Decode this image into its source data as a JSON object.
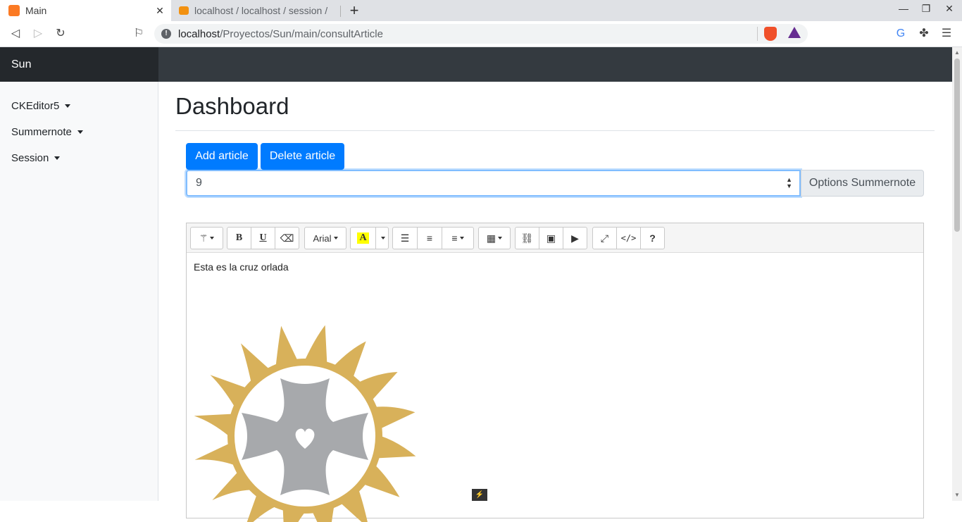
{
  "browser": {
    "tabs": [
      {
        "title": "Main",
        "active": true
      },
      {
        "title": "localhost / localhost / session /",
        "active": false
      }
    ],
    "url_host": "localhost",
    "url_path": "/Proyectos/Sun/main/consultArticle",
    "window_controls": [
      "minimize-icon",
      "restore-icon",
      "close-icon"
    ]
  },
  "app": {
    "brand": "Sun",
    "sidebar": {
      "items": [
        {
          "label": "CKEditor5"
        },
        {
          "label": "Summernote"
        },
        {
          "label": "Session"
        }
      ]
    },
    "page_title": "Dashboard",
    "buttons": {
      "add": "Add article",
      "delete": "Delete article",
      "options": "Options Summernote"
    },
    "article_select": {
      "value": "9"
    },
    "editor": {
      "font_name": "Arial",
      "content_text": "Esta es la cruz orlada",
      "highlight_color": "#ffff00",
      "image_colors": {
        "orle": "#d8b15a",
        "cross": "#a7a9ac"
      }
    }
  }
}
